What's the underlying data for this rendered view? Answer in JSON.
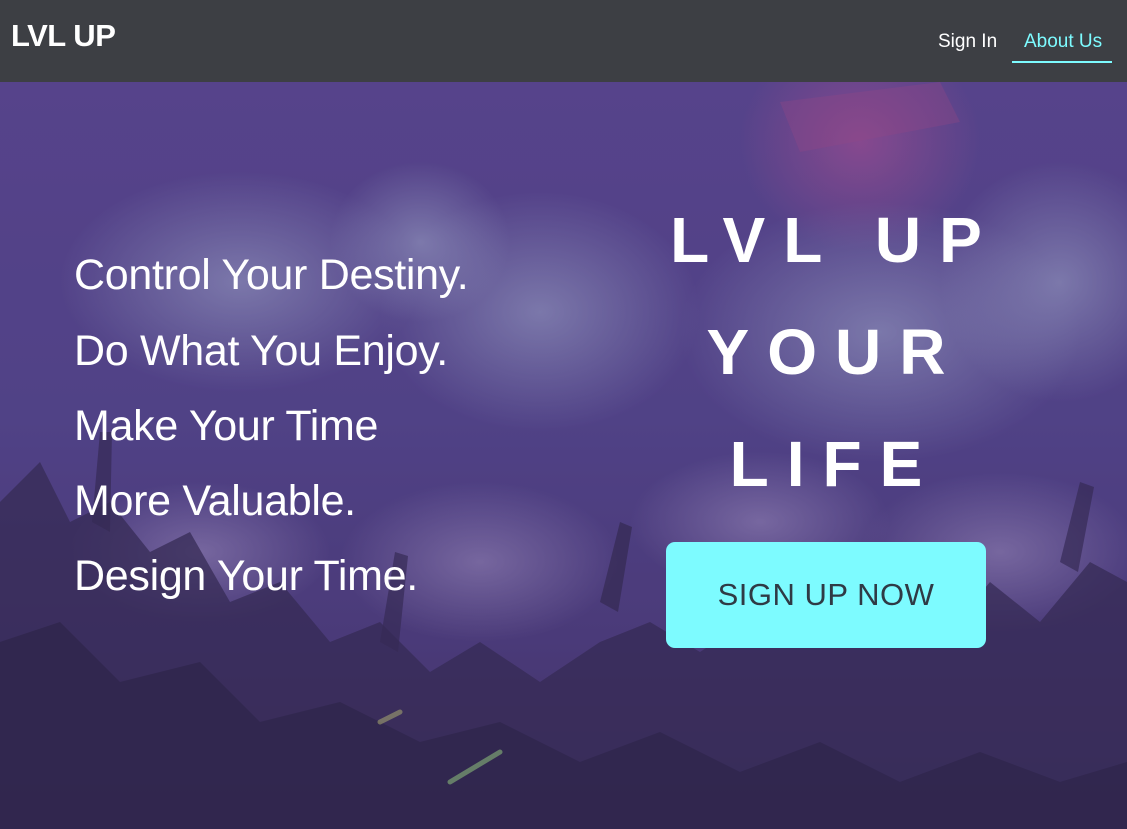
{
  "navbar": {
    "brand": "LVL UP",
    "links": [
      {
        "label": "Sign In",
        "active": false
      },
      {
        "label": "About Us",
        "active": true
      }
    ]
  },
  "hero": {
    "taglines": [
      "Control Your Destiny.",
      "Do What You Enjoy.",
      "Make Your Time",
      "More Valuable.",
      "Design Your Time."
    ],
    "headline": [
      "LVL UP",
      "YOUR",
      "LIFE"
    ],
    "cta_label": "SIGN UP NOW"
  },
  "colors": {
    "navbar_bg": "#3d3f44",
    "accent": "#7dfbff",
    "overlay": "#4a3a7a",
    "button_text": "#2f3a45"
  }
}
